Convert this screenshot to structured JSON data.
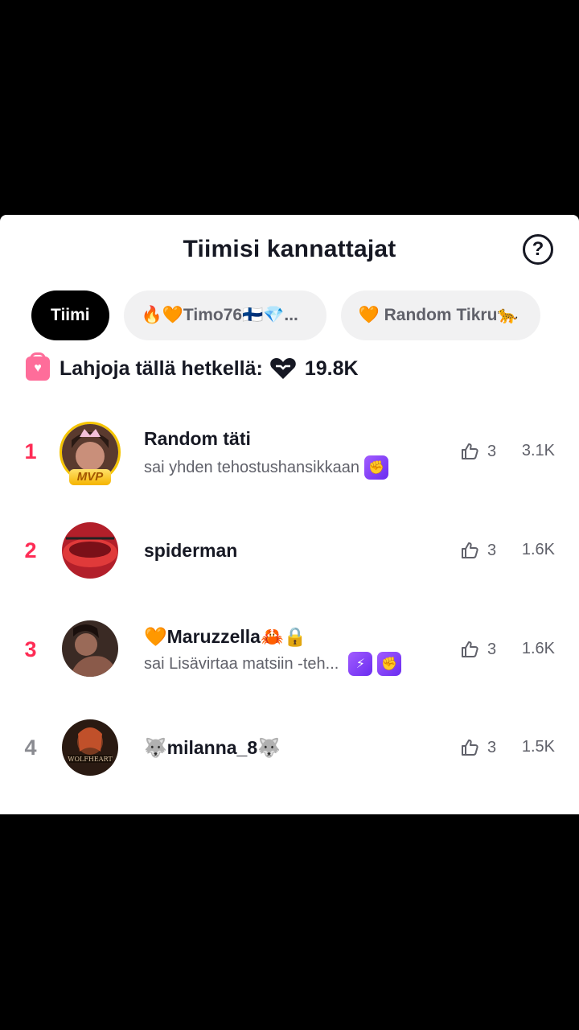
{
  "sheet": {
    "title": "Tiimisi kannattajat",
    "help_glyph": "?"
  },
  "tabs": [
    {
      "label": "Tiimi",
      "active": true
    },
    {
      "label": "🔥🧡Timo76🇫🇮💎...",
      "active": false
    },
    {
      "label": "🧡 Random Tikru🐆",
      "active": false
    }
  ],
  "gifts": {
    "label": "Lahjoja tällä hetkellä:",
    "value": "19.8K"
  },
  "supporters": [
    {
      "rank": "1",
      "name": "Random täti",
      "sub": "sai yhden tehostushansikkaan",
      "likes": "3",
      "score": "3.1K",
      "badge": "MVP",
      "avatar_color": "#5a3a2e"
    },
    {
      "rank": "2",
      "name": "spiderman",
      "sub": "",
      "likes": "3",
      "score": "1.6K",
      "avatar_color": "#b21f2a"
    },
    {
      "rank": "3",
      "name": "🧡Maruzzella🦀🔒",
      "sub": "sai Lisävirtaa matsiin -teh...",
      "likes": "3",
      "score": "1.6K",
      "avatar_color": "#3a2a24"
    },
    {
      "rank": "4",
      "name": "🐺milanna_8🐺",
      "sub": "",
      "likes": "3",
      "score": "1.5K",
      "avatar_color": "#3b2418"
    }
  ]
}
